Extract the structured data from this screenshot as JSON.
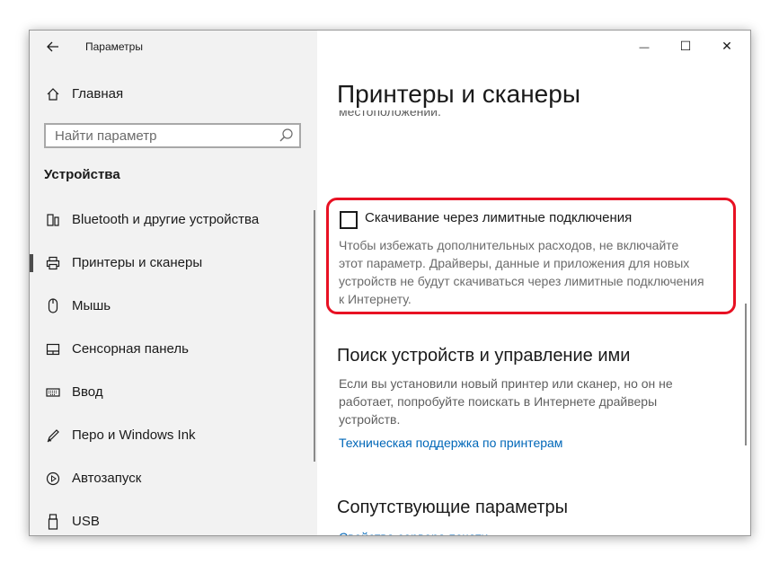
{
  "window": {
    "app_title": "Параметры",
    "controls": {
      "minimize": "—",
      "maximize": "☐",
      "close": "✕"
    }
  },
  "sidebar": {
    "home_label": "Главная",
    "search_placeholder": "Найти параметр",
    "section_title": "Устройства",
    "items": [
      {
        "label": "Bluetooth и другие устройства",
        "icon": "bluetooth-devices-icon",
        "selected": false
      },
      {
        "label": "Принтеры и сканеры",
        "icon": "printer-icon",
        "selected": true
      },
      {
        "label": "Мышь",
        "icon": "mouse-icon",
        "selected": false
      },
      {
        "label": "Сенсорная панель",
        "icon": "touchpad-icon",
        "selected": false
      },
      {
        "label": "Ввод",
        "icon": "keyboard-icon",
        "selected": false
      },
      {
        "label": "Перо и Windows Ink",
        "icon": "pen-icon",
        "selected": false
      },
      {
        "label": "Автозапуск",
        "icon": "autoplay-icon",
        "selected": false
      },
      {
        "label": "USB",
        "icon": "usb-icon",
        "selected": false
      }
    ]
  },
  "main": {
    "page_title": "Принтеры и сканеры",
    "clipped_text": "местоположении.",
    "metered": {
      "checkbox_label": "Скачивание через лимитные подключения",
      "checked": false,
      "description_lines": [
        "Чтобы избежать дополнительных расходов, не включайте",
        "этот параметр. Драйверы, данные и приложения для новых",
        "устройств не будут скачиваться через лимитные подключения",
        "к Интернету."
      ]
    },
    "find_devices": {
      "heading": "Поиск устройств и управление ими",
      "body_lines": [
        "Если вы установили новый принтер или сканер, но он не",
        "работает, попробуйте поискать в Интернете драйверы",
        "устройств."
      ],
      "link": "Техническая поддержка по принтерам"
    },
    "related": {
      "heading": "Сопутствующие параметры",
      "link_clipped": "Свойства сервера печати"
    }
  },
  "colors": {
    "highlight": "#e81123",
    "link": "#0067b8",
    "sidebar_bg": "#f2f2f2"
  }
}
